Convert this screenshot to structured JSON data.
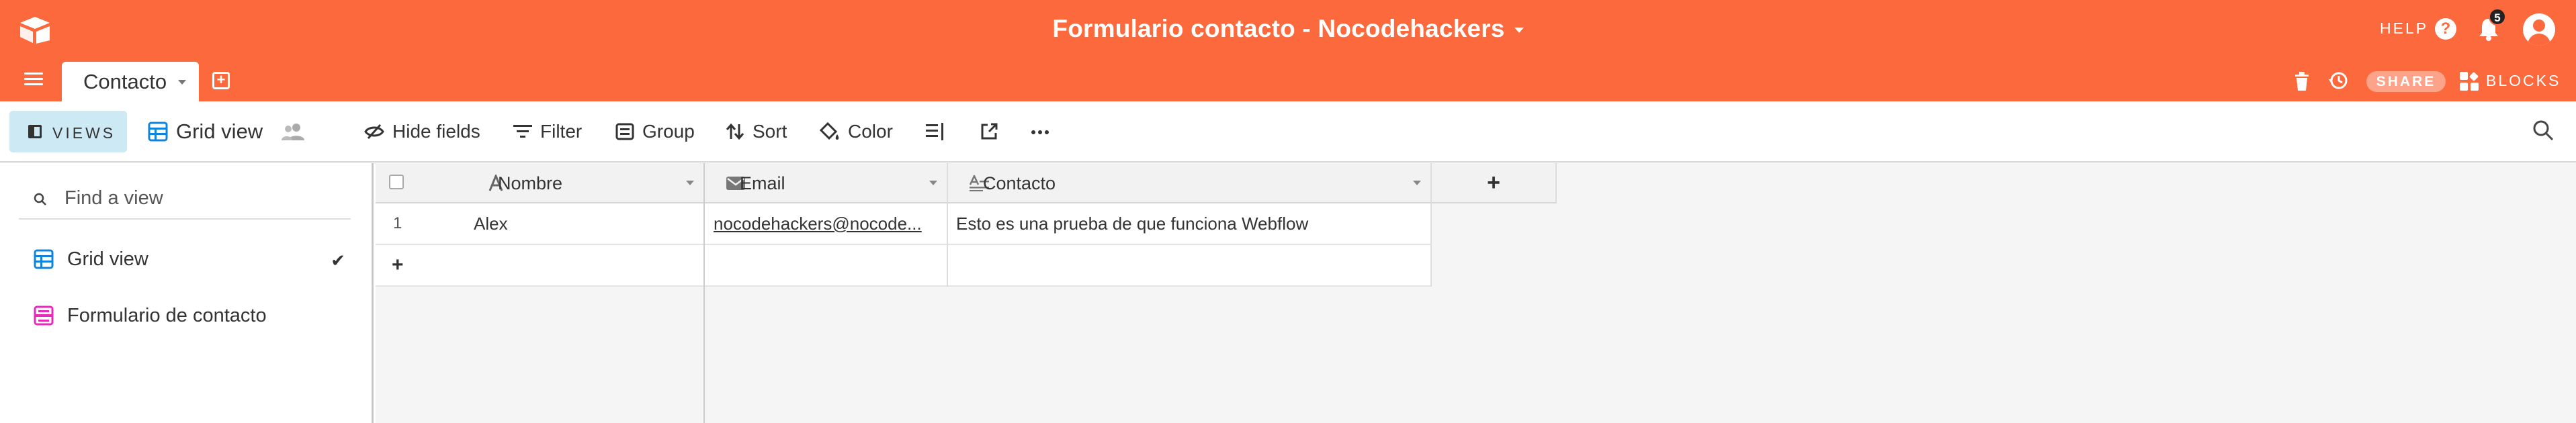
{
  "header": {
    "base_title": "Formulario contacto - Nocodehackers",
    "help_label": "HELP",
    "help_icon_glyph": "?",
    "notification_count": "5",
    "share_label": "SHARE",
    "blocks_label": "BLOCKS",
    "accent_color": "#fc693d"
  },
  "tables": {
    "active_tab": "Contacto",
    "add_icon_glyph": "+"
  },
  "viewbar": {
    "views_label": "VIEWS",
    "current_view": "Grid view",
    "hide_fields": "Hide fields",
    "filter": "Filter",
    "group": "Group",
    "sort": "Sort",
    "color": "Color"
  },
  "sidebar": {
    "search_placeholder": "Find a view",
    "items": [
      {
        "label": "Grid view",
        "icon": "grid-icon",
        "selected": true,
        "check_glyph": "✔"
      },
      {
        "label": "Formulario de contacto",
        "icon": "form-icon",
        "selected": false
      }
    ]
  },
  "grid": {
    "columns": [
      {
        "name": "Nombre",
        "icon": "text-icon"
      },
      {
        "name": "Email",
        "icon": "email-icon"
      },
      {
        "name": "Contacto",
        "icon": "long-text-icon"
      }
    ],
    "add_field_glyph": "+",
    "add_row_glyph": "+",
    "rows": [
      {
        "num": "1",
        "nombre": "Alex",
        "email": "nocodehackers@nocode...",
        "contacto": "Esto es una prueba de que funciona Webflow"
      }
    ]
  }
}
